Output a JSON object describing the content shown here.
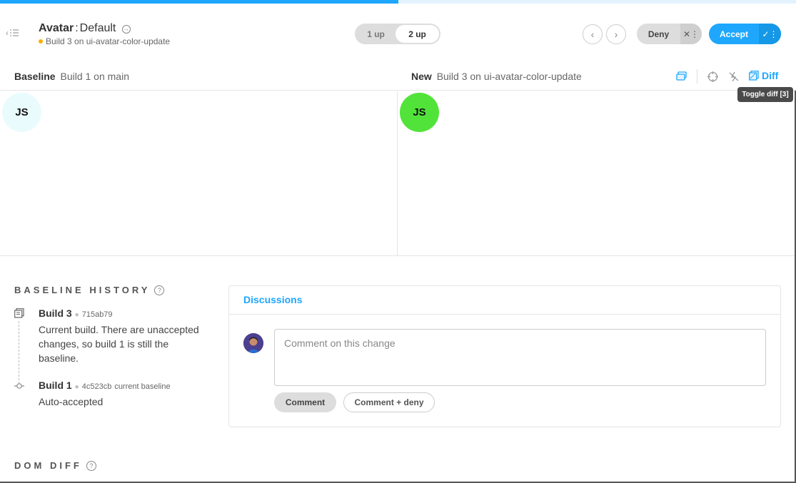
{
  "progress": {
    "fraction": 0.5,
    "color": "#1ea7fd"
  },
  "header": {
    "back_icon": "list-back-icon",
    "component": "Avatar",
    "separator": ":",
    "story": "Default",
    "build_status": "Build 3 on ui-avatar-color-update",
    "view_modes": [
      "1 up",
      "2 up"
    ],
    "active_view_mode": "2 up",
    "deny_label": "Deny",
    "accept_label": "Accept",
    "accent": "#1ea7fd"
  },
  "compare": {
    "baseline_label": "Baseline",
    "baseline_build": "Build 1 on main",
    "new_label": "New",
    "new_build": "Build 3 on ui-avatar-color-update",
    "diff_label": "Diff",
    "tooltip": "Toggle diff [3]"
  },
  "snapshots": {
    "baseline_initials": "JS",
    "baseline_color": "#e9fbfd",
    "new_initials": "JS",
    "new_color": "#52e33a"
  },
  "baseline_history": {
    "title": "BASELINE HISTORY",
    "items": [
      {
        "build": "Build 3",
        "sha": "715ab79",
        "tag": "",
        "description": "Current build. There are unaccepted changes, so build 1 is still the baseline."
      },
      {
        "build": "Build 1",
        "sha": "4c523cb",
        "tag": "current baseline",
        "description": "Auto-accepted"
      }
    ]
  },
  "discussions": {
    "tab": "Discussions",
    "placeholder": "Comment on this change",
    "comment_button": "Comment",
    "comment_deny_button": "Comment + deny"
  },
  "dom_diff": {
    "title": "DOM DIFF"
  }
}
